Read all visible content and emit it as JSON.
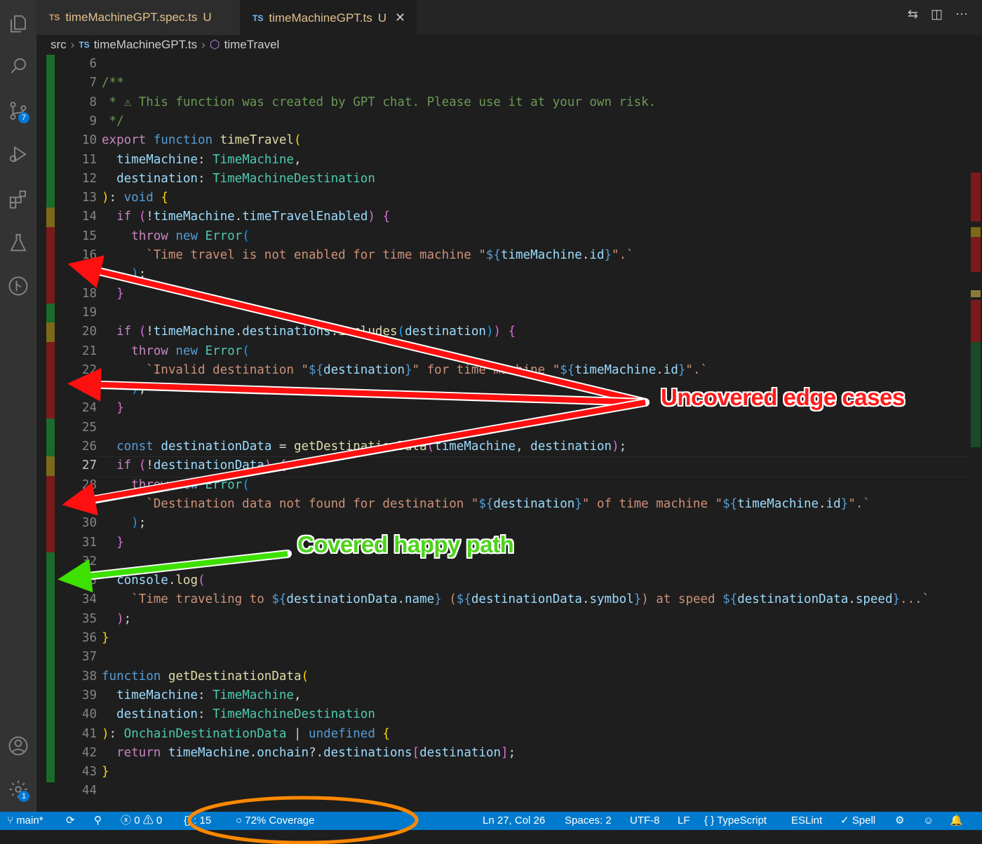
{
  "tabs": [
    {
      "lang": "TS",
      "label": "timeMachineGPT.spec.ts",
      "status": "U",
      "active": false
    },
    {
      "lang": "TS",
      "label": "timeMachineGPT.ts",
      "status": "U",
      "active": true
    }
  ],
  "breadcrumb": {
    "folder": "src",
    "file_lang": "TS",
    "file": "timeMachineGPT.ts",
    "symbol": "timeTravel"
  },
  "activity_bar": {
    "items": [
      "explorer-icon",
      "search-icon",
      "source-control-icon",
      "run-debug-icon",
      "extensions-icon",
      "testing-icon",
      "git-graph-icon"
    ],
    "source_control_badge": "7",
    "bottom_items": [
      "account-icon",
      "settings-gear-icon"
    ],
    "settings_badge": "1"
  },
  "editor": {
    "current_line": 27,
    "lines": [
      {
        "n": "6",
        "cov": "covered",
        "html": ""
      },
      {
        "n": "7",
        "cov": "covered",
        "html": "<span class=\"c\">/**</span>"
      },
      {
        "n": "8",
        "cov": "covered",
        "html": "<span class=\"c\"> * ⚠ This function was created by GPT chat. Please use it at your own risk.</span>"
      },
      {
        "n": "9",
        "cov": "covered",
        "html": "<span class=\"c\"> */</span>"
      },
      {
        "n": "10",
        "cov": "covered",
        "html": "<span class=\"kc\">export</span> <span class=\"k\">function</span> <span class=\"fn\">timeTravel</span><span class=\"p1\">(</span>"
      },
      {
        "n": "11",
        "cov": "covered",
        "html": "  <span class=\"v\">timeMachine</span>: <span class=\"ty\">TimeMachine</span>,"
      },
      {
        "n": "12",
        "cov": "covered",
        "html": "  <span class=\"v\">destination</span>: <span class=\"ty\">TimeMachineDestination</span>"
      },
      {
        "n": "13",
        "cov": "covered",
        "html": "<span class=\"p1\">)</span>: <span class=\"k\">void</span> <span class=\"p1\">{</span>"
      },
      {
        "n": "14",
        "cov": "partial",
        "html": "  <span class=\"kc\">if</span> <span class=\"p2\">(</span>!<span class=\"v\">timeMachine</span>.<span class=\"v\">timeTravelEnabled</span><span class=\"p2\">)</span> <span class=\"p2\">{</span>"
      },
      {
        "n": "15",
        "cov": "uncovered",
        "html": "    <span class=\"kc\">throw</span> <span class=\"k\">new</span> <span class=\"ty\">Error</span><span class=\"p3\">(</span>"
      },
      {
        "n": "16",
        "cov": "uncovered",
        "html": "      <span class=\"s\">`Time travel is not enabled for time machine \"</span><span class=\"k\">${</span><span class=\"v\">timeMachine</span>.<span class=\"v\">id</span><span class=\"k\">}</span><span class=\"s\">\".`</span>"
      },
      {
        "n": "17",
        "cov": "uncovered",
        "html": "    <span class=\"p3\">)</span>;"
      },
      {
        "n": "18",
        "cov": "uncovered",
        "html": "  <span class=\"p2\">}</span>"
      },
      {
        "n": "19",
        "cov": "covered",
        "html": ""
      },
      {
        "n": "20",
        "cov": "partial",
        "html": "  <span class=\"kc\">if</span> <span class=\"p2\">(</span>!<span class=\"v\">timeMachine</span>.<span class=\"v\">destinations</span>.<span class=\"fn\">includes</span><span class=\"p3\">(</span><span class=\"v\">destination</span><span class=\"p3\">)</span><span class=\"p2\">)</span> <span class=\"p2\">{</span>"
      },
      {
        "n": "21",
        "cov": "uncovered",
        "html": "    <span class=\"kc\">throw</span> <span class=\"k\">new</span> <span class=\"ty\">Error</span><span class=\"p3\">(</span>"
      },
      {
        "n": "22",
        "cov": "uncovered",
        "html": "      <span class=\"s\">`Invalid destination \"</span><span class=\"k\">${</span><span class=\"v\">destination</span><span class=\"k\">}</span><span class=\"s\">\" for time machine \"</span><span class=\"k\">${</span><span class=\"v\">timeMachine</span>.<span class=\"v\">id</span><span class=\"k\">}</span><span class=\"s\">\".`</span>"
      },
      {
        "n": "23",
        "cov": "uncovered",
        "html": "    <span class=\"p3\">)</span>;"
      },
      {
        "n": "24",
        "cov": "uncovered",
        "html": "  <span class=\"p2\">}</span>"
      },
      {
        "n": "25",
        "cov": "covered",
        "html": ""
      },
      {
        "n": "26",
        "cov": "covered",
        "html": "  <span class=\"k\">const</span> <span class=\"v\">destinationData</span> = <span class=\"fn\">getDestinationData</span><span class=\"p2\">(</span><span class=\"v\">timeMachine</span>, <span class=\"v\">destination</span><span class=\"p2\">)</span>;"
      },
      {
        "n": "27",
        "cov": "partial",
        "html": "  <span class=\"kc\">if</span> <span class=\"p2\">(</span>!<span class=\"v\">destinationData</span><span class=\"p2\">)</span> <span class=\"p2\">{</span>"
      },
      {
        "n": "28",
        "cov": "uncovered",
        "html": "    <span class=\"kc\">throw</span> <span class=\"k\">new</span> <span class=\"ty\">Error</span><span class=\"p3\">(</span>"
      },
      {
        "n": "29",
        "cov": "uncovered",
        "html": "      <span class=\"s\">`Destination data not found for destination \"</span><span class=\"k\">${</span><span class=\"v\">destination</span><span class=\"k\">}</span><span class=\"s\">\" of time machine \"</span><span class=\"k\">${</span><span class=\"v\">timeMachine</span>.<span class=\"v\">id</span><span class=\"k\">}</span><span class=\"s\">\".`</span>"
      },
      {
        "n": "30",
        "cov": "uncovered",
        "html": "    <span class=\"p3\">)</span>;"
      },
      {
        "n": "31",
        "cov": "uncovered",
        "html": "  <span class=\"p2\">}</span>"
      },
      {
        "n": "32",
        "cov": "covered",
        "html": ""
      },
      {
        "n": "33",
        "cov": "covered",
        "html": "  <span class=\"v\">console</span>.<span class=\"fn\">log</span><span class=\"p2\">(</span>"
      },
      {
        "n": "34",
        "cov": "covered",
        "html": "    <span class=\"s\">`Time traveling to </span><span class=\"k\">${</span><span class=\"v\">destinationData</span>.<span class=\"v\">name</span><span class=\"k\">}</span><span class=\"s\"> (</span><span class=\"k\">${</span><span class=\"v\">destinationData</span>.<span class=\"v\">symbol</span><span class=\"k\">}</span><span class=\"s\">) at speed </span><span class=\"k\">${</span><span class=\"v\">destinationData</span>.<span class=\"v\">speed</span><span class=\"k\">}</span><span class=\"s\">...`</span>"
      },
      {
        "n": "35",
        "cov": "covered",
        "html": "  <span class=\"p2\">)</span>;"
      },
      {
        "n": "36",
        "cov": "covered",
        "html": "<span class=\"p1\">}</span>"
      },
      {
        "n": "37",
        "cov": "covered",
        "html": ""
      },
      {
        "n": "38",
        "cov": "covered",
        "html": "<span class=\"k\">function</span> <span class=\"fn\">getDestinationData</span><span class=\"p1\">(</span>"
      },
      {
        "n": "39",
        "cov": "covered",
        "html": "  <span class=\"v\">timeMachine</span>: <span class=\"ty\">TimeMachine</span>,"
      },
      {
        "n": "40",
        "cov": "covered",
        "html": "  <span class=\"v\">destination</span>: <span class=\"ty\">TimeMachineDestination</span>"
      },
      {
        "n": "41",
        "cov": "covered",
        "html": "<span class=\"p1\">)</span>: <span class=\"ty\">OnchainDestinationData</span> | <span class=\"k\">undefined</span> <span class=\"p1\">{</span>"
      },
      {
        "n": "42",
        "cov": "covered",
        "html": "  <span class=\"kc\">return</span> <span class=\"v\">timeMachine</span>.<span class=\"v\">onchain</span>?.<span class=\"v\">destinations</span><span class=\"p2\">[</span><span class=\"v\">destination</span><span class=\"p2\">]</span>;"
      },
      {
        "n": "43",
        "cov": "covered",
        "html": "<span class=\"p1\">}</span>"
      },
      {
        "n": "44",
        "cov": "none",
        "html": ""
      }
    ]
  },
  "coverage_colors": {
    "covered": "#1a6b2a",
    "partial": "#7a6a1a",
    "uncovered": "#7a1a1a"
  },
  "status_bar": {
    "branch": "main*",
    "errors": "0",
    "warnings": "0",
    "info_suffix": ": 15",
    "coverage": "72% Coverage",
    "cursor": "Ln 27, Col 26",
    "spaces": "Spaces: 2",
    "encoding": "UTF-8",
    "eol": "LF",
    "language": "TypeScript",
    "linter": "ESLint",
    "spell": "Spell"
  },
  "annotations": {
    "uncovered_label": "Uncovered edge cases",
    "covered_label": "Covered happy path",
    "arrow_red": "#ff1010",
    "arrow_green": "#3ee000",
    "circle_orange": "#ff8800"
  }
}
